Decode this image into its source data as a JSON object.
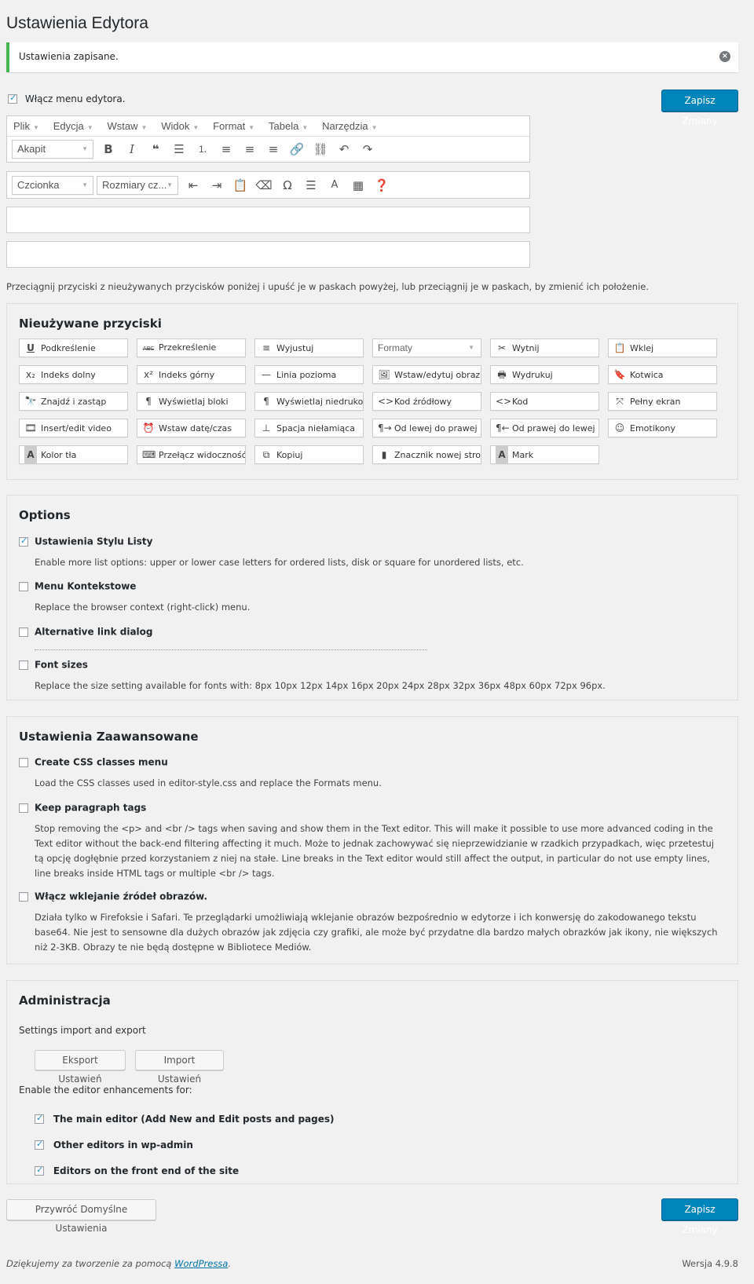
{
  "page_title": "Ustawienia Edytora",
  "notice": {
    "message": "Ustawienia zapisane.",
    "dismiss_icon": "dismiss-circle-icon"
  },
  "enable_menu": {
    "label": "Włącz menu edytora.",
    "checked": true
  },
  "save_button": "Zapisz Zmiany",
  "menubar": [
    "Plik",
    "Edycja",
    "Wstaw",
    "Widok",
    "Format",
    "Tabela",
    "Narzędzia"
  ],
  "toolbar1": {
    "format_select": "Akapit",
    "buttons": [
      "bold",
      "italic",
      "blockquote",
      "bullet-list",
      "numbered-list",
      "align-left",
      "align-center",
      "align-right",
      "link",
      "unlink",
      "undo",
      "redo"
    ]
  },
  "toolbar2": {
    "font_select": "Czcionka",
    "size_select": "Rozmiary cz...",
    "buttons": [
      "outdent",
      "indent",
      "paste-as-text",
      "clear-formatting",
      "special-character",
      "read-more",
      "text-color",
      "table",
      "help"
    ]
  },
  "hint": "Przeciągnij przyciski z nieużywanych przycisków poniżej i upuść je w paskach powyżej, lub przeciągnij je w paskach, by zmienić ich położenie.",
  "unused": {
    "title": "Nieużywane przyciski",
    "rows": [
      [
        {
          "icon": "U",
          "label": "Podkreślenie"
        },
        {
          "icon": "ABC",
          "label": "Przekreślenie"
        },
        {
          "icon": "≡",
          "label": "Wyjustuj"
        },
        {
          "icon": "",
          "label": "Formaty",
          "select": true
        },
        {
          "icon": "✂",
          "label": "Wytnij"
        },
        {
          "icon": "📋",
          "label": "Wklej"
        }
      ],
      [
        {
          "icon": "x₂",
          "label": "Indeks dolny"
        },
        {
          "icon": "x²",
          "label": "Indeks górny"
        },
        {
          "icon": "—",
          "label": "Linia pozioma"
        },
        {
          "icon": "🖼",
          "label": "Wstaw/edytuj obraz..."
        },
        {
          "icon": "🖶",
          "label": "Wydrukuj"
        },
        {
          "icon": "🔖",
          "label": "Kotwica"
        }
      ],
      [
        {
          "icon": "🔭",
          "label": "Znajdź i zastąp"
        },
        {
          "icon": "¶",
          "label": "Wyświetlaj bloki"
        },
        {
          "icon": "¶",
          "label": "Wyświetlaj niedruko..."
        },
        {
          "icon": "<>",
          "label": "Kod źródłowy"
        },
        {
          "icon": "<>",
          "label": "Kod"
        },
        {
          "icon": "⤧",
          "label": "Pełny ekran"
        }
      ],
      [
        {
          "icon": "🎞",
          "label": "Insert/edit video"
        },
        {
          "icon": "⏰",
          "label": "Wstaw datę/czas"
        },
        {
          "icon": "⊥",
          "label": "Spacja niełamiąca"
        },
        {
          "icon": "¶→",
          "label": "Od lewej do prawej"
        },
        {
          "icon": "¶←",
          "label": "Od prawej do lewej"
        },
        {
          "icon": "☺",
          "label": "Emotikony"
        }
      ],
      [
        {
          "icon": "A",
          "label": "Kolor tła"
        },
        {
          "icon": "⌨",
          "label": "Przełącz widoczność..."
        },
        {
          "icon": "⧉",
          "label": "Kopiuj"
        },
        {
          "icon": "▮",
          "label": "Znacznik nowej stro..."
        },
        {
          "icon": "A",
          "label": "Mark"
        }
      ]
    ]
  },
  "options": {
    "title": "Options",
    "items": [
      {
        "label": "Ustawienia Stylu Listy",
        "checked": true,
        "desc": "Enable more list options: upper or lower case letters for ordered lists, disk or square for unordered lists, etc."
      },
      {
        "label": "Menu Kontekstowe",
        "checked": false,
        "desc": "Replace the browser context (right-click) menu."
      },
      {
        "label": "Alternative link dialog",
        "checked": false,
        "desc": ""
      },
      {
        "label": "Font sizes",
        "checked": false,
        "desc": "Replace the size setting available for fonts with: 8px 10px 12px 14px 16px 20px 24px 28px 32px 36px 48px 60px 72px 96px."
      }
    ]
  },
  "advanced": {
    "title": "Ustawienia Zaawansowane",
    "items": [
      {
        "label": "Create CSS classes menu",
        "checked": false,
        "desc": "Load the CSS classes used in editor-style.css and replace the Formats menu."
      },
      {
        "label": "Keep paragraph tags",
        "checked": false,
        "desc": "Stop removing the <p> and <br /> tags when saving and show them in the Text editor. This will make it possible to use more advanced coding in the Text editor without the back-end filtering affecting it much. Może to jednak zachowywać się nieprzewidzianie w rzadkich przypadkach, więc przetestuj tą opcję dogłębnie przed korzystaniem z niej na stałe. Line breaks in the Text editor would still affect the output, in particular do not use empty lines, line breaks inside HTML tags or multiple <br /> tags."
      },
      {
        "label": "Włącz wklejanie źródeł obrazów.",
        "checked": false,
        "desc": "Działa tylko w Firefoksie i Safari. Te przeglądarki umożliwiają wklejanie obrazów bezpośrednio w edytorze i ich konwersję do zakodowanego tekstu base64. Nie jest to sensowne dla dużych obrazów jak zdjęcia czy grafiki, ale może być przydatne dla bardzo małych obrazków jak ikony, nie większych niż 2-3KB. Obrazy te nie będą dostępne w Bibliotece Mediów."
      }
    ]
  },
  "admin": {
    "title": "Administracja",
    "import_export_label": "Settings import and export",
    "export_button": "Eksport Ustawień",
    "import_button": "Import Ustawień",
    "enable_for_label": "Enable the editor enhancements for:",
    "targets": [
      {
        "label": "The main editor (Add New and Edit posts and pages)",
        "checked": true
      },
      {
        "label": "Other editors in wp-admin",
        "checked": true
      },
      {
        "label": "Editors on the front end of the site",
        "checked": true
      }
    ]
  },
  "restore_button": "Przywróć Domyślne Ustawienia",
  "footer": {
    "thanks_prefix": "Dziękujemy za tworzenie za pomocą ",
    "thanks_link": "WordPressa",
    "thanks_suffix": ".",
    "version": "Wersja 4.9.8"
  },
  "colors": {
    "primary": "#0085ba",
    "success": "#46b450",
    "background": "#f1f1f1"
  }
}
